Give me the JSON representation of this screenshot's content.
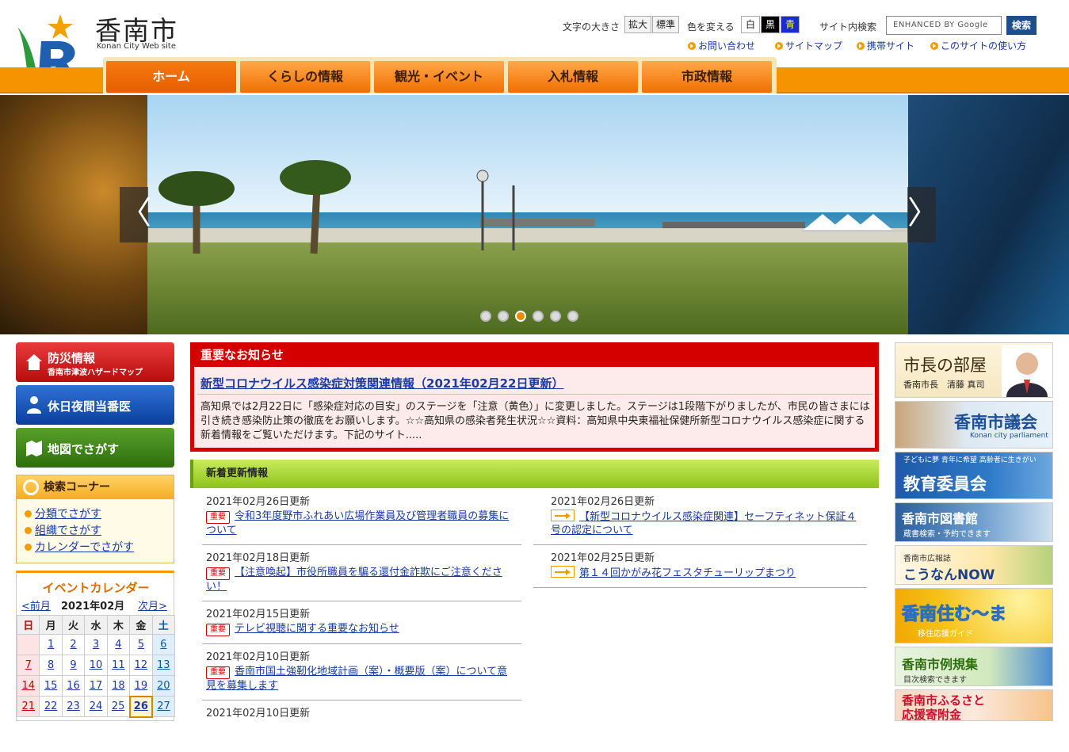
{
  "site": {
    "title": "香南市",
    "subtitle": "Konan City Web site"
  },
  "util": {
    "font_size_label": "文字の大きさ",
    "enlarge": "拡大",
    "standard": "標準",
    "color_label": "色を変える",
    "white": "白",
    "black": "黒",
    "blue": "青",
    "search_label": "サイト内検索",
    "search_placeholder": "ENHANCED BY Google",
    "search_button": "検索"
  },
  "sublinks": [
    "お問い合わせ",
    "サイトマップ",
    "携帯サイト",
    "このサイトの使い方"
  ],
  "nav": [
    "ホーム",
    "くらしの情報",
    "観光・イベント",
    "入札情報",
    "市政情報"
  ],
  "hero": {
    "prev": "〈",
    "next": "〉",
    "slides": 6,
    "active_slide": 3
  },
  "left": {
    "disaster": {
      "title": "防災情報",
      "sub": "香南市津波ハザードマップ"
    },
    "holiday_doctor": "休日夜間当番医",
    "map": "地図でさがす",
    "search_corner": {
      "title": "検索コーナー",
      "links": [
        "分類でさがす",
        "組織でさがす",
        "カレンダーでさがす"
      ]
    },
    "calendar": {
      "title": "イベントカレンダー",
      "prev": "<前月",
      "month": "2021年02月",
      "next": "次月>",
      "weekdays": [
        "日",
        "月",
        "火",
        "水",
        "木",
        "金",
        "土"
      ],
      "weeks": [
        [
          "",
          "1",
          "2",
          "3",
          "4",
          "5",
          "6"
        ],
        [
          "7",
          "8",
          "9",
          "10",
          "11",
          "12",
          "13"
        ],
        [
          "14",
          "15",
          "16",
          "17",
          "18",
          "19",
          "20"
        ],
        [
          "21",
          "22",
          "23",
          "24",
          "25",
          "26",
          "27"
        ]
      ],
      "today": "26"
    }
  },
  "notice": {
    "title": "重要なお知らせ",
    "link": "新型コロナウイルス感染症対策関連情報（2021年02月22日更新）",
    "body": "高知県では2月22日に「感染症対応の目安」のステージを「注意（黄色）」に変更しました。ステージは1段階下がりましたが、市民の皆さまには引き続き感染防止策の徹底をお願いします。☆☆高知県の感染者発生状況☆☆資料：高知県中央東福祉保健所新型コロナウイルス感染症に関する新着情報をご覧いただけます。下記のサイト....."
  },
  "news": {
    "title": "新着更新情報",
    "badge": "重要",
    "left": [
      {
        "date": "2021年02月26日更新",
        "text": "令和3年度野市ふれあい広場作業員及び管理者職員の募集について",
        "important": true
      },
      {
        "date": "2021年02月18日更新",
        "text": "【注意喚起】市役所職員を騙る還付金詐欺にご注意ください！",
        "important": true
      },
      {
        "date": "2021年02月15日更新",
        "text": "テレビ視聴に関する重要なお知らせ",
        "important": true
      },
      {
        "date": "2021年02月10日更新",
        "text": "香南市国土強靭化地域計画（案）・概要版（案）について意見を募集します",
        "important": true
      },
      {
        "date": "2021年02月10日更新",
        "text": "",
        "important": false
      }
    ],
    "right": [
      {
        "date": "2021年02月26日更新",
        "text": "【新型コロナウイルス感染症関連】セーフティネット保証４号の認定について"
      },
      {
        "date": "2021年02月25日更新",
        "text": "第１４回かがみ花フェスタチューリップまつり"
      }
    ]
  },
  "right": {
    "mayor": {
      "title": "市長の部屋",
      "sub": "香南市長　清藤 真司"
    },
    "council": {
      "title": "香南市議会",
      "sub": "Konan city parliament"
    },
    "education": {
      "title": "教育委員会",
      "sub": "子どもに夢 青年に希望 高齢者に生きがい"
    },
    "library": {
      "title": "香南市図書館",
      "sub": "蔵書検索・予約できます"
    },
    "pr": {
      "sub": "香南市広報誌",
      "title": "こうなんNOW"
    },
    "living": {
      "title": "香南住む〜ま",
      "sub": "移住応援ガイド"
    },
    "rules": {
      "title": "香南市例規集",
      "sub": "目次検索できます"
    },
    "furusato": {
      "title": "香南市ふるさと応援寄附金"
    }
  },
  "colors": {
    "orange": "#f59400",
    "red": "#d40000",
    "green": "#8ec21d",
    "blue": "#1e4e8c"
  }
}
